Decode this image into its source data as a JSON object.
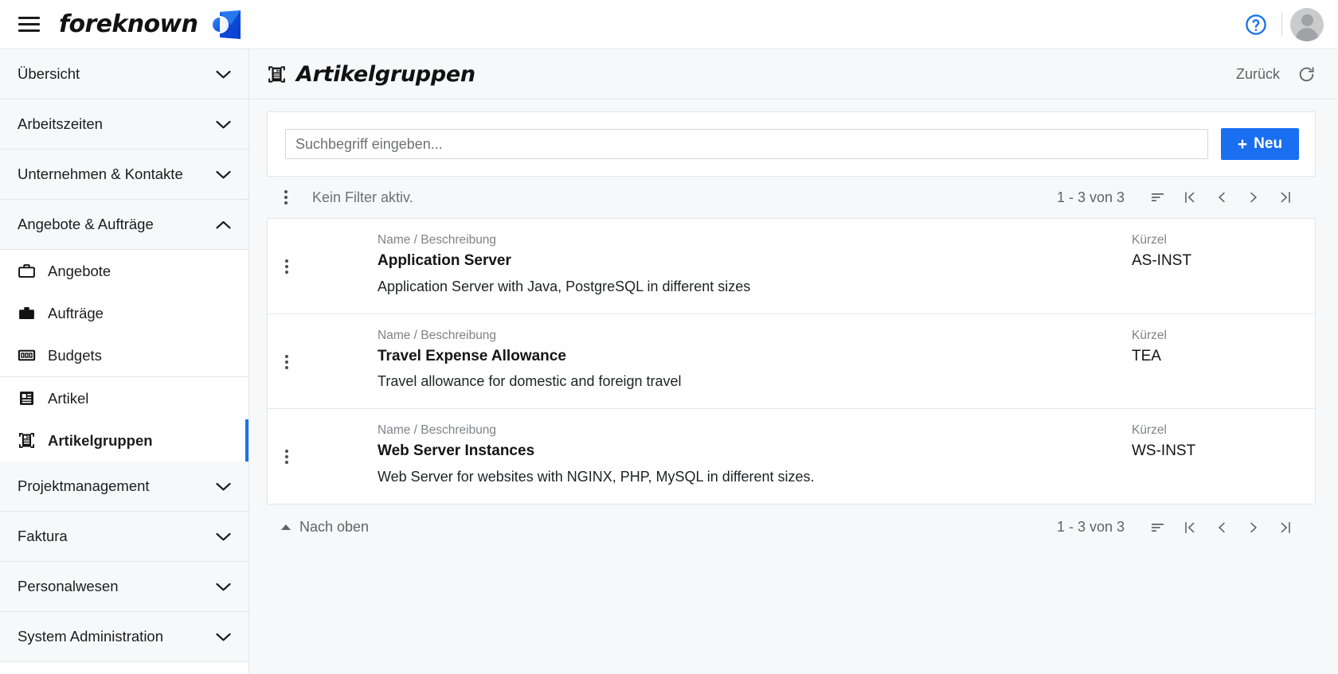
{
  "topbar": {
    "menu_icon": "hamburger-menu-icon",
    "brand_name": "foreknown",
    "brand_mark": "foreknown-logo-mark",
    "help_icon": "help-circle-icon",
    "avatar": "user-avatar",
    "accent_color": "#1a6ef0",
    "help_color": "#1a73e8"
  },
  "sidebar": {
    "groups": [
      {
        "label": "Übersicht",
        "expanded": false
      },
      {
        "label": "Arbeitszeiten",
        "expanded": false
      },
      {
        "label": "Unternehmen & Kontakte",
        "expanded": false
      },
      {
        "label": "Angebote & Aufträge",
        "expanded": true
      }
    ],
    "group_items": [
      {
        "label": "Angebote",
        "icon": "briefcase-outline-icon",
        "active": false
      },
      {
        "label": "Aufträge",
        "icon": "briefcase-filled-icon",
        "active": false
      },
      {
        "label": "Budgets",
        "icon": "money-100-icon",
        "active": false
      },
      {
        "label": "Artikel",
        "icon": "article-icon",
        "active": false
      },
      {
        "label": "Artikelgruppen",
        "icon": "article-group-icon",
        "active": true
      }
    ],
    "groups_after": [
      {
        "label": "Projektmanagement",
        "expanded": false
      },
      {
        "label": "Faktura",
        "expanded": false
      },
      {
        "label": "Personalwesen",
        "expanded": false
      },
      {
        "label": "System Administration",
        "expanded": false
      }
    ],
    "active_indicator_color": "#1a73e8"
  },
  "page": {
    "title": "Artikelgruppen",
    "title_icon": "article-group-icon",
    "back_label": "Zurück",
    "refresh_icon": "refresh-icon"
  },
  "toolbar": {
    "search_placeholder": "Suchbegriff eingeben...",
    "search_value": "",
    "new_label": "Neu",
    "new_plus": "+"
  },
  "filterbar": {
    "kebab_icon": "more-vertical-icon",
    "filter_text": "Kein Filter aktiv.",
    "count": "1 - 3 von 3",
    "sort_icon": "sort-icon",
    "first_icon": "first-page-icon",
    "prev_icon": "previous-page-icon",
    "next_icon": "next-page-icon",
    "last_icon": "last-page-icon"
  },
  "table": {
    "labels": {
      "name": "Name / Beschreibung",
      "kuerzel": "Kürzel"
    },
    "rows": [
      {
        "name": "Application Server",
        "description": "Application Server with Java, PostgreSQL in different sizes",
        "kuerzel": "AS-INST"
      },
      {
        "name": "Travel Expense Allowance",
        "description": "Travel allowance for domestic and foreign travel",
        "kuerzel": "TEA"
      },
      {
        "name": "Web Server Instances",
        "description": "Web Server for websites with NGINX, PHP, MySQL in different sizes.",
        "kuerzel": "WS-INST"
      }
    ]
  },
  "bottombar": {
    "scroll_top_label": "Nach oben",
    "count": "1 - 3 von 3"
  }
}
